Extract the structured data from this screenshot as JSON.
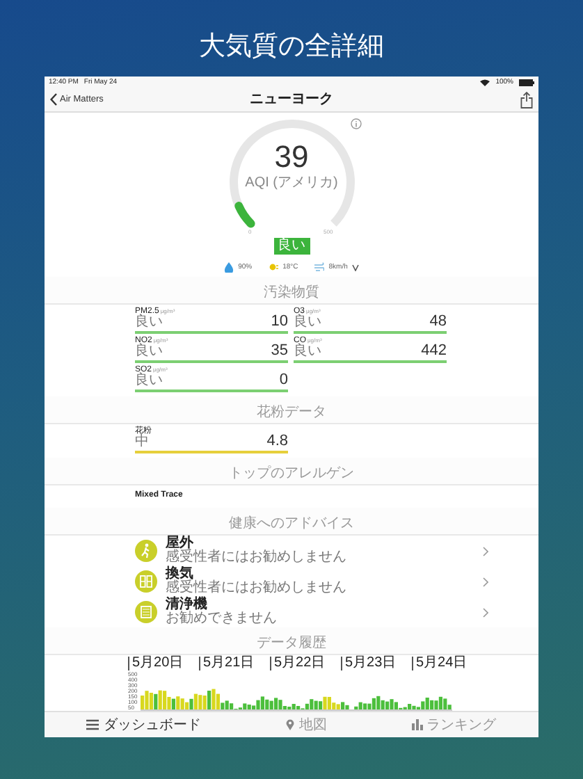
{
  "headline": "大気質の全詳細",
  "status_bar": {
    "time": "12:40 PM",
    "date": "Fri May 24",
    "battery": "100%"
  },
  "nav": {
    "back": "Air Matters",
    "title": "ニューヨーク"
  },
  "gauge": {
    "value": "39",
    "label": "AQI (アメリカ)",
    "min": "0",
    "max": "500",
    "badge": "良い",
    "color": "#3cb43c"
  },
  "weather": [
    {
      "kind": "humidity",
      "text": "90%"
    },
    {
      "kind": "temperature",
      "text": "18°C"
    },
    {
      "kind": "wind",
      "text": "8km/h"
    }
  ],
  "pollutants": {
    "title": "汚染物質",
    "items": [
      {
        "name": "PM2.5",
        "unit": "μg/m³",
        "status": "良い",
        "value": "10",
        "color": "#7ccf72"
      },
      {
        "name": "O3",
        "unit": "μg/m³",
        "status": "良い",
        "value": "48",
        "color": "#7ccf72"
      },
      {
        "name": "NO2",
        "unit": "μg/m³",
        "status": "良い",
        "value": "35",
        "color": "#7ccf72"
      },
      {
        "name": "CO",
        "unit": "μg/m³",
        "status": "良い",
        "value": "442",
        "color": "#7ccf72"
      },
      {
        "name": "SO2",
        "unit": "μg/m³",
        "status": "良い",
        "value": "0",
        "color": "#7ccf72"
      }
    ]
  },
  "pollen": {
    "title": "花粉データ",
    "items": [
      {
        "name": "花粉",
        "status": "中",
        "value": "4.8",
        "color": "#e6cf3c"
      }
    ]
  },
  "allergen": {
    "title": "トップのアレルゲン",
    "text": "Mixed Trace"
  },
  "advice": {
    "title": "健康へのアドバイス",
    "items": [
      {
        "kind": "outdoor",
        "title": "屋外",
        "text": "感受性者にはお勧めしません"
      },
      {
        "kind": "window",
        "title": "換気",
        "text": "感受性者にはお勧めしません"
      },
      {
        "kind": "purifier",
        "title": "清浄機",
        "text": "お勧めできません"
      }
    ]
  },
  "history": {
    "title": "データ履歴",
    "dates": [
      "5月20日",
      "5月21日",
      "5月22日",
      "5月23日",
      "5月24日"
    ],
    "yticks": [
      "500",
      "400",
      "300",
      "200",
      "150",
      "100",
      "50"
    ]
  },
  "tabs": [
    {
      "kind": "list",
      "label": "ダッシュボード",
      "selected": true
    },
    {
      "kind": "pin",
      "label": "地図",
      "selected": false
    },
    {
      "kind": "bars",
      "label": "ランキング",
      "selected": false
    }
  ]
}
